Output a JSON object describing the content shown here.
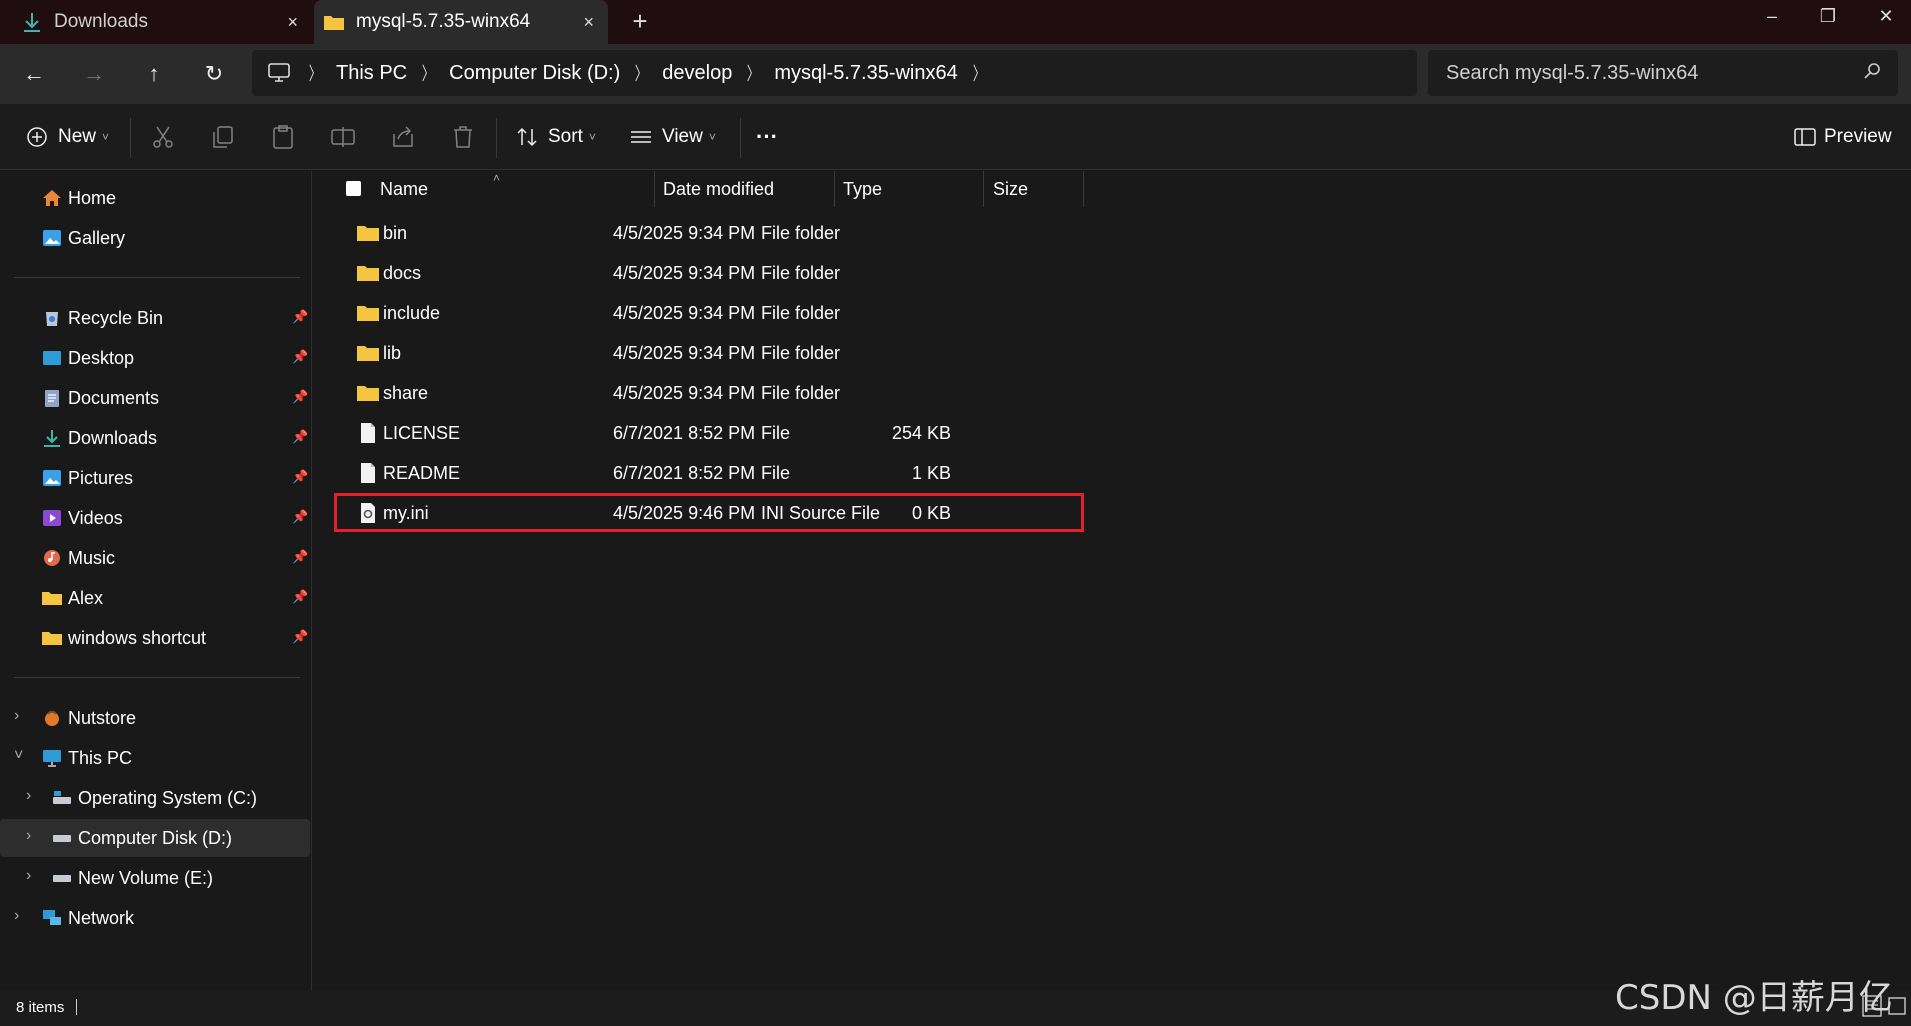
{
  "tabs": [
    {
      "label": "Downloads",
      "close": "×"
    },
    {
      "label": "mysql-5.7.35-winx64",
      "close": "×"
    }
  ],
  "new_tab": "+",
  "window_controls": {
    "minimize": "–",
    "restore": "❐",
    "close": "✕"
  },
  "nav": {
    "back": "←",
    "forward": "→",
    "up": "↑",
    "refresh": "↻"
  },
  "breadcrumb": [
    "This PC",
    "Computer Disk (D:)",
    "develop",
    "mysql-5.7.35-winx64"
  ],
  "search": {
    "placeholder": "Search mysql-5.7.35-winx64"
  },
  "toolbar": {
    "new_label": "New",
    "sort_label": "Sort",
    "view_label": "View",
    "more_label": "···",
    "preview_label": "Preview"
  },
  "sidebar": {
    "top": [
      {
        "label": "Home",
        "icon": "home-icon"
      },
      {
        "label": "Gallery",
        "icon": "gallery-icon"
      }
    ],
    "pinned": [
      {
        "label": "Recycle Bin",
        "icon": "recycle-bin-icon"
      },
      {
        "label": "Desktop",
        "icon": "desktop-icon"
      },
      {
        "label": "Documents",
        "icon": "documents-icon"
      },
      {
        "label": "Downloads",
        "icon": "downloads-icon"
      },
      {
        "label": "Pictures",
        "icon": "pictures-icon"
      },
      {
        "label": "Videos",
        "icon": "videos-icon"
      },
      {
        "label": "Music",
        "icon": "music-icon"
      },
      {
        "label": "Alex",
        "icon": "folder-icon"
      },
      {
        "label": "windows shortcut",
        "icon": "folder-icon"
      }
    ],
    "tree": [
      {
        "label": "Nutstore",
        "icon": "nutstore-icon"
      },
      {
        "label": "This PC",
        "icon": "pc-icon"
      },
      {
        "label": "Operating System (C:)",
        "icon": "drive-icon"
      },
      {
        "label": "Computer Disk (D:)",
        "icon": "drive-icon"
      },
      {
        "label": "New Volume (E:)",
        "icon": "drive-icon"
      },
      {
        "label": "Network",
        "icon": "network-icon"
      }
    ]
  },
  "columns": {
    "name": "Name",
    "date": "Date modified",
    "type": "Type",
    "size": "Size"
  },
  "files": [
    {
      "name": "bin",
      "date": "4/5/2025 9:34 PM",
      "type": "File folder",
      "size": "",
      "icon": "folder-icon"
    },
    {
      "name": "docs",
      "date": "4/5/2025 9:34 PM",
      "type": "File folder",
      "size": "",
      "icon": "folder-icon"
    },
    {
      "name": "include",
      "date": "4/5/2025 9:34 PM",
      "type": "File folder",
      "size": "",
      "icon": "folder-icon"
    },
    {
      "name": "lib",
      "date": "4/5/2025 9:34 PM",
      "type": "File folder",
      "size": "",
      "icon": "folder-icon"
    },
    {
      "name": "share",
      "date": "4/5/2025 9:34 PM",
      "type": "File folder",
      "size": "",
      "icon": "folder-icon"
    },
    {
      "name": "LICENSE",
      "date": "6/7/2021 8:52 PM",
      "type": "File",
      "size": "254 KB",
      "icon": "file-icon"
    },
    {
      "name": "README",
      "date": "6/7/2021 8:52 PM",
      "type": "File",
      "size": "1 KB",
      "icon": "file-icon"
    },
    {
      "name": "my.ini",
      "date": "4/5/2025 9:46 PM",
      "type": "INI Source File",
      "size": "0 KB",
      "icon": "ini-file-icon"
    }
  ],
  "status": {
    "item_count": "8 items"
  },
  "watermark": "CSDN @日薪月亿",
  "colors": {
    "highlight": "#e0202a",
    "folder": "#f5c542",
    "selected_bg": "#2d2d2d"
  }
}
